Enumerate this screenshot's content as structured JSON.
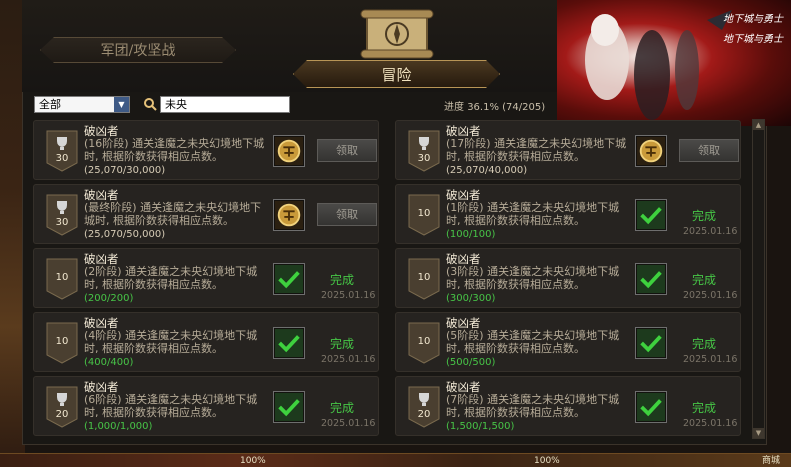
{
  "tabs": {
    "siege": "军团/攻坚战",
    "adventure": "冒险"
  },
  "filter": {
    "selected": "全部"
  },
  "search": {
    "value": "未央"
  },
  "progress": {
    "label": "进度",
    "percent": "36.1%",
    "count": "(74/205)"
  },
  "banner": {
    "logo_line1": "地下城与勇士",
    "logo_line2": "地下城与勇士"
  },
  "colors": {
    "complete_green": "#46c646",
    "gold": "#b89556"
  },
  "cards": [
    {
      "title": "破凶者",
      "desc": "(16阶段) 通关逢魔之未央幻境地下城时, 根据阶数获得相应点数。",
      "progress": "(25,070/30,000)",
      "badge_num": "30",
      "badge_icon": "trophy-icon",
      "action": "领取",
      "state": "claimable",
      "date": ""
    },
    {
      "title": "破凶者",
      "desc": "(17阶段) 通关逢魔之未央幻境地下城时, 根据阶数获得相应点数。",
      "progress": "(25,070/40,000)",
      "badge_num": "30",
      "badge_icon": "trophy-icon",
      "action": "领取",
      "state": "claimable",
      "date": ""
    },
    {
      "title": "破凶者",
      "desc": "(最终阶段) 通关逢魔之未央幻境地下城时, 根据阶数获得相应点数。",
      "progress": "(25,070/50,000)",
      "badge_num": "30",
      "badge_icon": "trophy-icon",
      "action": "领取",
      "state": "claimable",
      "date": ""
    },
    {
      "title": "破凶者",
      "desc": "(1阶段) 通关逢魔之未央幻境地下城时, 根据阶数获得相应点数。",
      "progress": "(100/100)",
      "badge_num": "10",
      "badge_icon": "",
      "action": "完成",
      "state": "done",
      "date": "2025.01.16"
    },
    {
      "title": "破凶者",
      "desc": "(2阶段) 通关逢魔之未央幻境地下城时, 根据阶数获得相应点数。",
      "progress": "(200/200)",
      "badge_num": "10",
      "badge_icon": "",
      "action": "完成",
      "state": "done",
      "date": "2025.01.16"
    },
    {
      "title": "破凶者",
      "desc": "(3阶段) 通关逢魔之未央幻境地下城时, 根据阶数获得相应点数。",
      "progress": "(300/300)",
      "badge_num": "10",
      "badge_icon": "",
      "action": "完成",
      "state": "done",
      "date": "2025.01.16"
    },
    {
      "title": "破凶者",
      "desc": "(4阶段) 通关逢魔之未央幻境地下城时, 根据阶数获得相应点数。",
      "progress": "(400/400)",
      "badge_num": "10",
      "badge_icon": "",
      "action": "完成",
      "state": "done",
      "date": "2025.01.16"
    },
    {
      "title": "破凶者",
      "desc": "(5阶段) 通关逢魔之未央幻境地下城时, 根据阶数获得相应点数。",
      "progress": "(500/500)",
      "badge_num": "10",
      "badge_icon": "",
      "action": "完成",
      "state": "done",
      "date": "2025.01.16"
    },
    {
      "title": "破凶者",
      "desc": "(6阶段) 通关逢魔之未央幻境地下城时, 根据阶数获得相应点数。",
      "progress": "(1,000/1,000)",
      "badge_num": "20",
      "badge_icon": "trophy-icon",
      "action": "完成",
      "state": "done",
      "date": "2025.01.16"
    },
    {
      "title": "破凶者",
      "desc": "(7阶段) 通关逢魔之未央幻境地下城时, 根据阶数获得相应点数。",
      "progress": "(1,500/1,500)",
      "badge_num": "20",
      "badge_icon": "trophy-icon",
      "action": "完成",
      "state": "done",
      "date": "2025.01.16"
    }
  ],
  "bottom_bar": {
    "hp": "100%",
    "mp": "100%",
    "shop": "商城"
  }
}
